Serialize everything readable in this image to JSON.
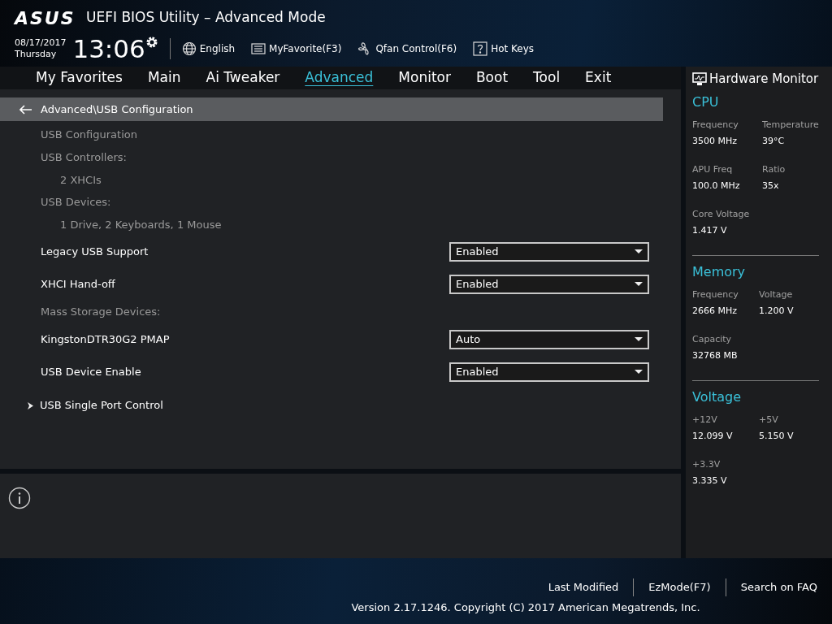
{
  "header": {
    "brand": "ASUS",
    "title": "UEFI BIOS Utility – Advanced Mode",
    "date": "08/17/2017",
    "day": "Thursday",
    "time": "13:06",
    "tools": [
      {
        "kind": "globe",
        "label": "English"
      },
      {
        "kind": "list",
        "label": "MyFavorite(F3)"
      },
      {
        "kind": "fan",
        "label": "Qfan Control(F6)"
      },
      {
        "kind": "help",
        "label": "Hot Keys"
      }
    ]
  },
  "tabs": [
    {
      "label": "My Favorites",
      "selected": false
    },
    {
      "label": "Main",
      "selected": false
    },
    {
      "label": "Ai Tweaker",
      "selected": false
    },
    {
      "label": "Advanced",
      "selected": true
    },
    {
      "label": "Monitor",
      "selected": false
    },
    {
      "label": "Boot",
      "selected": false
    },
    {
      "label": "Tool",
      "selected": false
    },
    {
      "label": "Exit",
      "selected": false
    }
  ],
  "breadcrumb": "Advanced\\USB Configuration",
  "settings": [
    {
      "kind": "header",
      "label": "USB Configuration"
    },
    {
      "kind": "header",
      "label": "USB Controllers:"
    },
    {
      "kind": "value",
      "label": "2 XHCIs"
    },
    {
      "kind": "header",
      "label": "USB Devices:"
    },
    {
      "kind": "value",
      "label": "1 Drive, 2 Keyboards, 1 Mouse"
    },
    {
      "kind": "dropdown",
      "label": "Legacy USB Support",
      "value": "Enabled"
    },
    {
      "kind": "dropdown",
      "label": "XHCI Hand-off",
      "value": "Enabled"
    },
    {
      "kind": "header",
      "label": "Mass Storage Devices:"
    },
    {
      "kind": "dropdown",
      "label": "KingstonDTR30G2 PMAP",
      "value": "Auto"
    },
    {
      "kind": "dropdown",
      "label": "USB Device Enable",
      "value": "Enabled"
    },
    {
      "kind": "submenu",
      "label": "USB Single Port Control"
    }
  ],
  "hardware_monitor": {
    "title": "Hardware Monitor",
    "sections": [
      {
        "title": "CPU",
        "items": [
          {
            "label": "Frequency",
            "value": "3500 MHz"
          },
          {
            "label": "Temperature",
            "value": "39°C"
          },
          {
            "label": "APU Freq",
            "value": "100.0 MHz"
          },
          {
            "label": "Ratio",
            "value": "35x"
          },
          {
            "label": "Core Voltage",
            "value": "1.417 V"
          }
        ]
      },
      {
        "title": "Memory",
        "items": [
          {
            "label": "Frequency",
            "value": "2666 MHz"
          },
          {
            "label": "Voltage",
            "value": "1.200 V"
          },
          {
            "label": "Capacity",
            "value": "32768 MB"
          }
        ]
      },
      {
        "title": "Voltage",
        "items": [
          {
            "label": "+12V",
            "value": "12.099 V"
          },
          {
            "label": "+5V",
            "value": "5.150 V"
          },
          {
            "label": "+3.3V",
            "value": "3.335 V"
          }
        ]
      }
    ]
  },
  "footer": {
    "links": [
      "Last Modified",
      "EzMode(F7)",
      "Search on FAQ"
    ],
    "version": "Version 2.17.1246. Copyright (C) 2017 American Megatrends, Inc."
  }
}
